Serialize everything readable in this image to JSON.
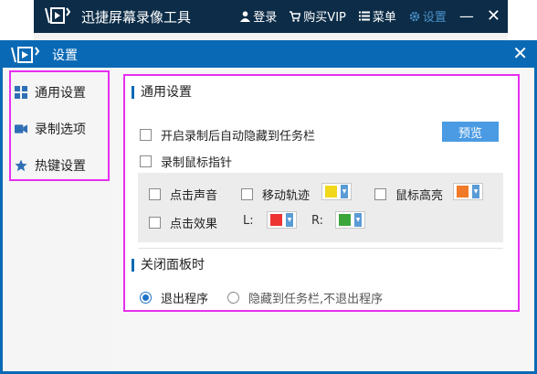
{
  "background_app": {
    "title": "迅捷屏幕录像工具",
    "login_label": "登录",
    "vip_label": "购买VIP",
    "menu_label": "菜单",
    "settings_label": "设置"
  },
  "dialog": {
    "title": "设置",
    "sidebar": {
      "items": [
        {
          "label": "通用设置",
          "icon": "grid-icon"
        },
        {
          "label": "录制选项",
          "icon": "video-camera-icon"
        },
        {
          "label": "热键设置",
          "icon": "star-icon"
        }
      ]
    },
    "general": {
      "section_title": "通用设置",
      "auto_hide_label": "开启录制后自动隐藏到任务栏",
      "preview_label": "预览",
      "record_cursor_label": "录制鼠标指针",
      "click_sound_label": "点击声音",
      "move_trail_label": "移动轨迹",
      "cursor_highlight_label": "鼠标高亮",
      "click_effect_label": "点击效果",
      "left_label": "L:",
      "right_label": "R:",
      "colors": {
        "move_trail": "#f2d81c",
        "cursor_highlight": "#f07a27",
        "left_click": "#ee3333",
        "right_click": "#3aa63a"
      }
    },
    "close_panel": {
      "section_title": "关闭面板时",
      "exit_label": "退出程序",
      "hide_label": "隐藏到任务栏,不退出程序",
      "selected": "exit"
    }
  }
}
